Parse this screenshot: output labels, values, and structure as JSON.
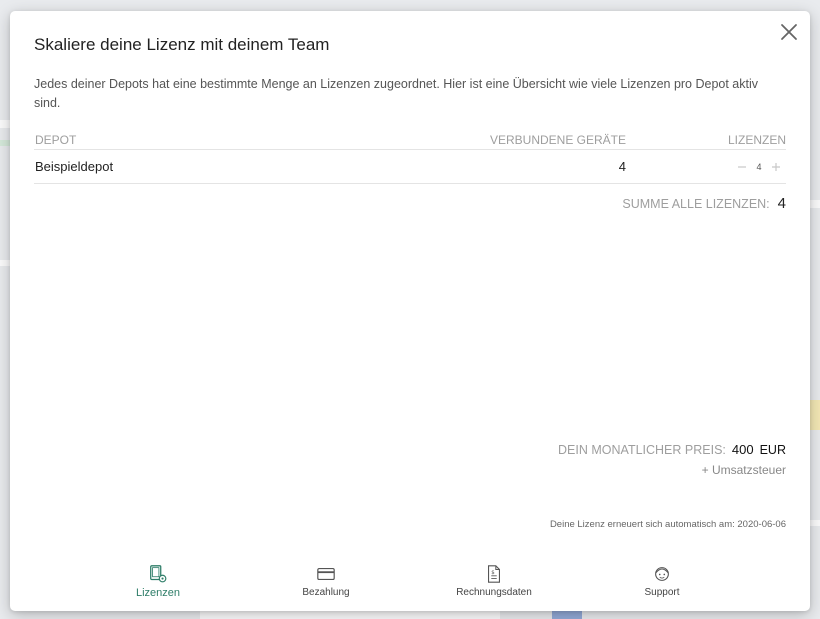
{
  "dialog": {
    "title": "Skaliere deine Lizenz mit deinem Team",
    "description": "Jedes deiner Depots hat eine bestimmte Menge an Lizenzen zugeordnet. Hier ist eine Übersicht wie viele Lizenzen pro Depot aktiv sind."
  },
  "table": {
    "headers": {
      "depot": "Depot",
      "devices": "Verbundene Geräte",
      "licenses": "Lizenzen"
    },
    "rows": [
      {
        "depot": "Beispieldepot",
        "devices": "4",
        "licenses": "4"
      }
    ]
  },
  "summary": {
    "label": "Summe alle Lizenzen:",
    "value": "4"
  },
  "price": {
    "label": "Dein monatlicher Preis:",
    "value": "400",
    "currency": "EUR",
    "tax_note": "+ Umsatzsteuer"
  },
  "renewal": {
    "text": "Deine Lizenz erneuert sich automatisch am: 2020-06-06"
  },
  "tabs": [
    {
      "label": "Lizenzen",
      "icon": "devices-icon",
      "active": true
    },
    {
      "label": "Bezahlung",
      "icon": "credit-card-icon",
      "active": false
    },
    {
      "label": "Rechnungsdaten",
      "icon": "invoice-icon",
      "active": false
    },
    {
      "label": "Support",
      "icon": "support-icon",
      "active": false
    }
  ],
  "colors": {
    "accent": "#2e7d68",
    "muted": "#9e9e9e"
  }
}
